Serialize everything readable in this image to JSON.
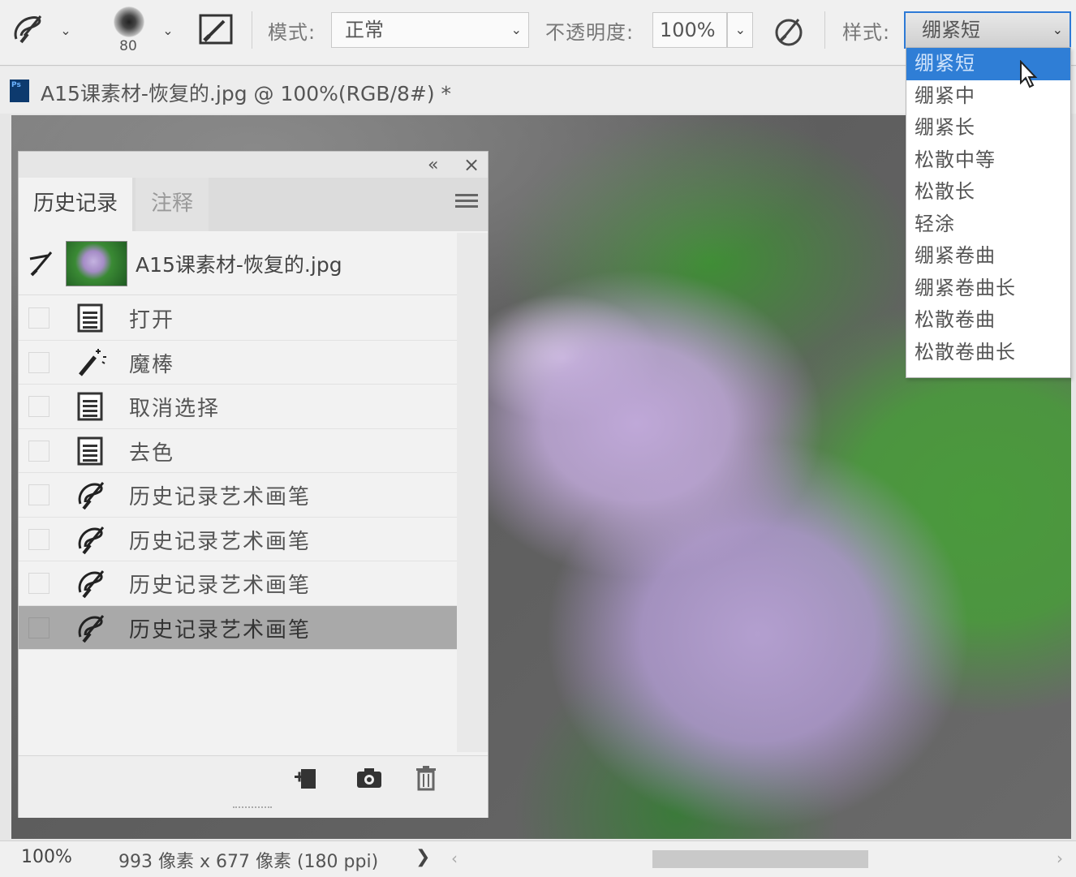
{
  "options_bar": {
    "brush_size": "80",
    "mode_label": "模式:",
    "mode_value": "正常",
    "opacity_label": "不透明度:",
    "opacity_value": "100%",
    "style_label": "样式:",
    "style_value": "绷紧短"
  },
  "style_dropdown": {
    "items": [
      "绷紧短",
      "绷紧中",
      "绷紧长",
      "松散中等",
      "松散长",
      "轻涂",
      "绷紧卷曲",
      "绷紧卷曲长",
      "松散卷曲",
      "松散卷曲长"
    ],
    "highlighted_index": 0
  },
  "document": {
    "tab_title": "A15课素材-恢复的.jpg @ 100%(RGB/8#) *"
  },
  "history_panel": {
    "tabs": [
      "历史记录",
      "注释"
    ],
    "active_tab": 0,
    "snapshot_label": "A15课素材-恢复的.jpg",
    "states": [
      {
        "label": "打开",
        "icon": "document-icon"
      },
      {
        "label": "魔棒",
        "icon": "magic-wand-icon"
      },
      {
        "label": "取消选择",
        "icon": "document-icon"
      },
      {
        "label": "去色",
        "icon": "document-icon"
      },
      {
        "label": "历史记录艺术画笔",
        "icon": "art-history-brush-icon"
      },
      {
        "label": "历史记录艺术画笔",
        "icon": "art-history-brush-icon"
      },
      {
        "label": "历史记录艺术画笔",
        "icon": "art-history-brush-icon"
      },
      {
        "label": "历史记录艺术画笔",
        "icon": "art-history-brush-icon"
      }
    ],
    "selected_state_index": 7
  },
  "status_bar": {
    "zoom": "100%",
    "doc_info": "993 像素 x 677 像素 (180 ppi)",
    "arrow": "❯"
  },
  "colors": {
    "accent": "#2f7ed6",
    "selected_row": "#a9a9a9"
  }
}
